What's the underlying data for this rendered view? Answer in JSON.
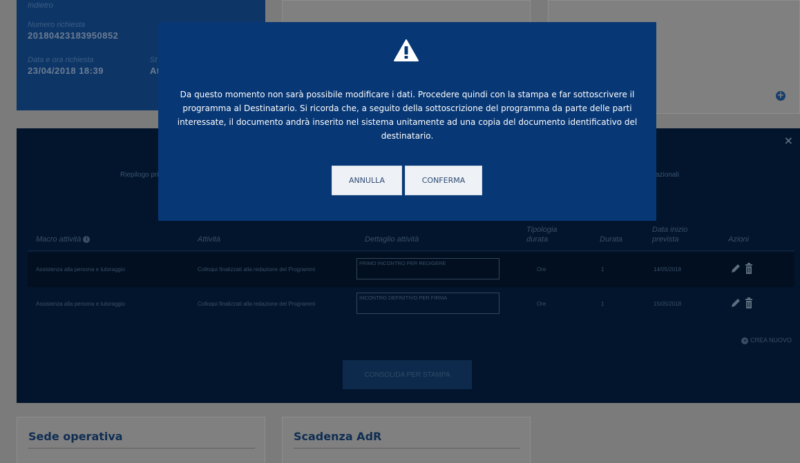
{
  "top_card": {
    "top_label": "Indietro",
    "request_number_label": "Numero richiesta",
    "request_number": "20180423183950852",
    "datetime_label": "Data e ora richiesta",
    "datetime": "23/04/2018 18:39",
    "status_label": "St",
    "status_value": "At"
  },
  "panel": {
    "summary_text_left": "Riepilogo pri",
    "summary_text_right": "azionali",
    "columns": [
      "Macro attività",
      "Attività",
      "Dettaglio attività",
      "Tipologia durata",
      "Durata",
      "Data inizio prevista",
      "Azioni"
    ],
    "rows": [
      {
        "macro": "Assistenza alla persona e tutoraggio",
        "activity": "Colloqui finalizzati alla redazione del Programmi",
        "detail": "PRIMO INCONTRO PER REDIGERE",
        "type": "Ore",
        "duration": "1",
        "start_date": "14/05/2018"
      },
      {
        "macro": "Assistenza alla persona e tutoraggio",
        "activity": "Colloqui finalizzati alla redazione del Programmi",
        "detail": "INCONTRO DEFINITIVO PER FIRMA",
        "type": "Ore",
        "duration": "1",
        "start_date": "15/05/2018"
      }
    ],
    "create_new_label": "CREA NUOVO",
    "consolidate_label": "CONSOLIDA PER STAMPA",
    "close_symbol": "×"
  },
  "bottom_cards": {
    "left_title": "Sede operativa",
    "right_title": "Scadenza AdR"
  },
  "modal": {
    "icon": "warning-triangle-icon",
    "message": "Da questo momento non sarà possibile modificare i dati. Procedere quindi con la stampa e far sottoscrivere il programma al Destinatario. Si ricorda che, a seguito della sottoscrizione del programma da parte delle parti interessate, il documento andrà inserito nel sistema unitamente ad una copia del documento identificativo del destinatario.",
    "cancel_label": "ANNULLA",
    "confirm_label": "CONFERMA"
  },
  "colors": {
    "modal_bg": "#073775",
    "overlay": "#7b7b7b",
    "panel_bg": "#02152d"
  }
}
